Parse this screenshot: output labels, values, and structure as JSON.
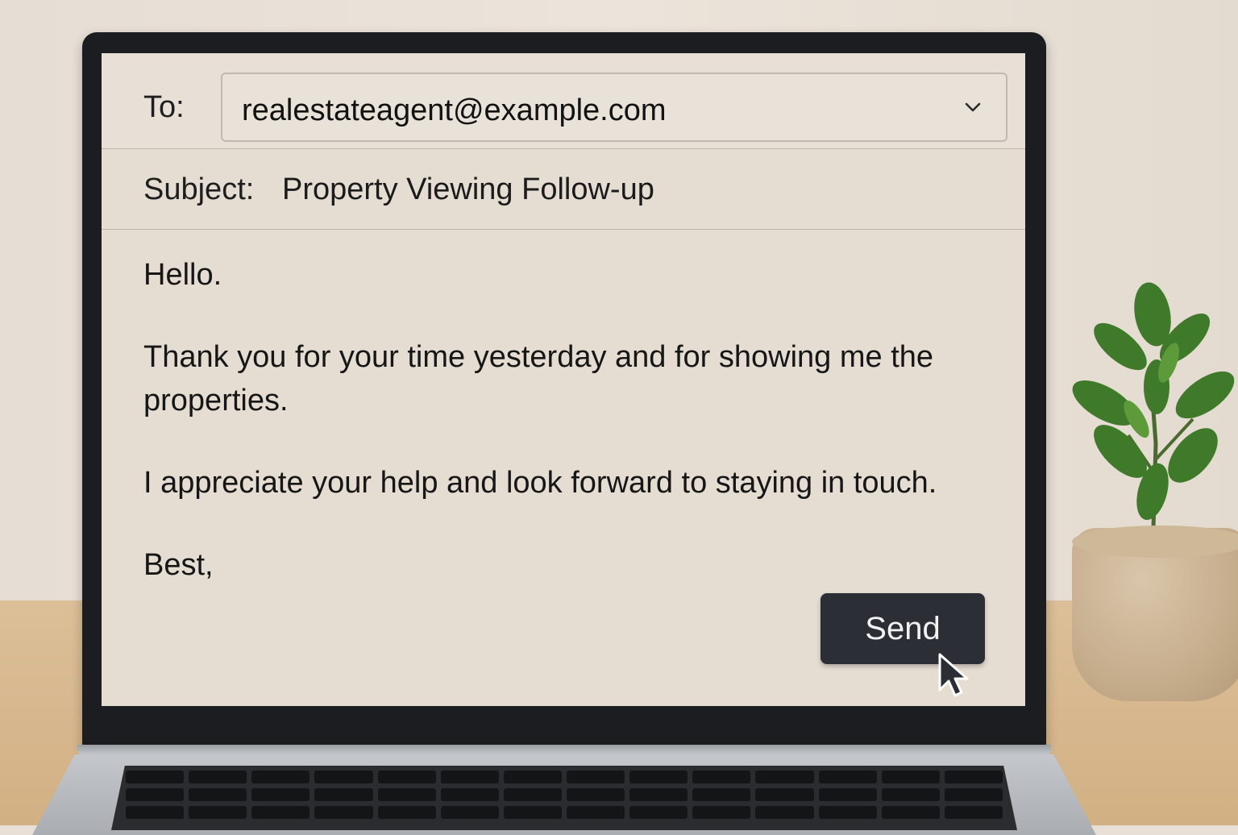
{
  "compose": {
    "to_label": "To:",
    "to_value": "realestateagent@example.com",
    "subject_label": "Subject:",
    "subject_value": "Property Viewing Follow-up",
    "body": {
      "greeting": "Hello.",
      "paragraph1": "Thank you for your time yesterday and for showing me the properties.",
      "paragraph2": "I appreciate your help and look forward to staying in touch.",
      "signoff": "Best,"
    },
    "send_label": "Send"
  },
  "icons": {
    "dropdown": "chevron-down-icon",
    "cursor": "mouse-pointer-icon"
  },
  "colors": {
    "screen_bg": "#e6ddd2",
    "send_button_bg": "#2b2f35",
    "text": "#161616"
  }
}
